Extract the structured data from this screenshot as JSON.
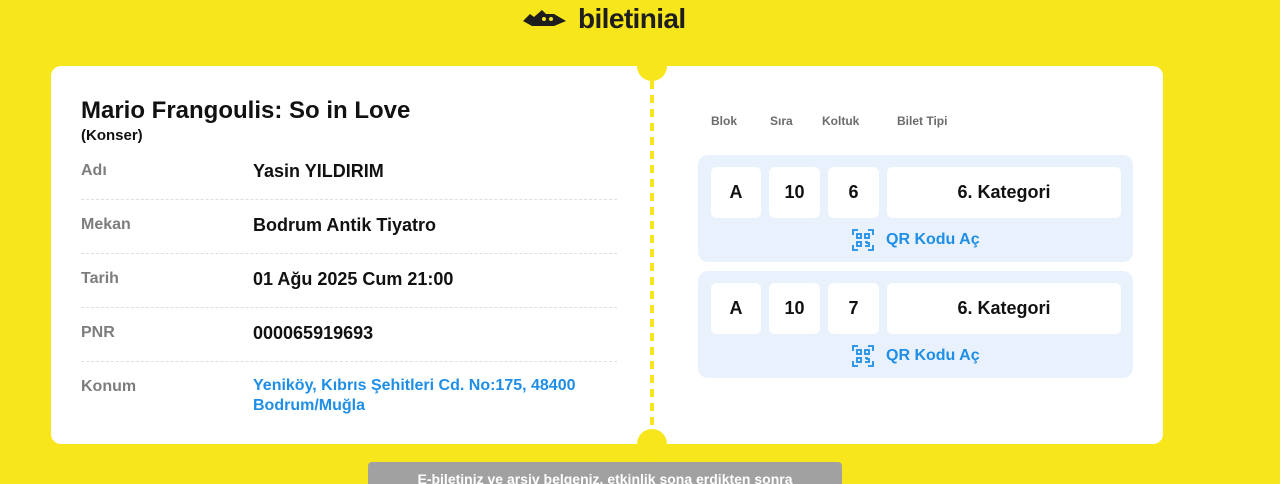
{
  "brand": {
    "name": "biletinial"
  },
  "event": {
    "title": "Mario Frangoulis: So in Love",
    "type": "(Konser)"
  },
  "details": [
    {
      "label": "Adı",
      "value": "Yasin YILDIRIM"
    },
    {
      "label": "Mekan",
      "value": "Bodrum Antik Tiyatro"
    },
    {
      "label": "Tarih",
      "value": "01 Ağu 2025 Cum 21:00"
    },
    {
      "label": "PNR",
      "value": "000065919693"
    },
    {
      "label": "Konum",
      "value": "Yeniköy, Kıbrıs Şehitleri Cd. No:175, 48400 Bodrum/Muğla"
    }
  ],
  "seat_headers": {
    "block": "Blok",
    "row": "Sıra",
    "seat": "Koltuk",
    "ticket_type": "Bilet Tipi"
  },
  "seats": [
    {
      "block": "A",
      "row": "10",
      "seat": "6",
      "ticket_type": "6. Kategori",
      "qr_label": "QR Kodu Aç"
    },
    {
      "block": "A",
      "row": "10",
      "seat": "7",
      "ticket_type": "6. Kategori",
      "qr_label": "QR Kodu Aç"
    }
  ],
  "notice": "E-biletiniz ve arşiv belgeniz, etkinlik sona erdikten sonra",
  "colors": {
    "background": "#f7e61b",
    "link": "#1e8ee6",
    "seat_card": "#e9f2fc",
    "notice_bg": "#a1a1a1"
  }
}
